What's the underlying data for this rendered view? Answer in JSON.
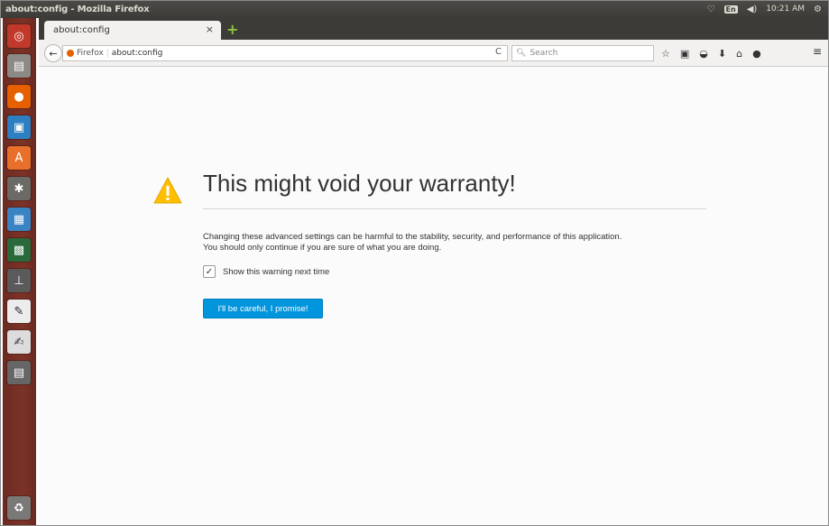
{
  "window": {
    "title": "about:config - Mozilla Firefox"
  },
  "panel": {
    "keyboard_badge": "En",
    "time": "10:21 AM"
  },
  "tabs": [
    {
      "label": "about:config",
      "close": "×"
    }
  ],
  "newtab": {
    "label": "+"
  },
  "navbar": {
    "back": "←",
    "identity": "Firefox",
    "url": "about:config",
    "reload": "C",
    "search_placeholder": "Search",
    "menu": "≡"
  },
  "content": {
    "title": "This might void your warranty!",
    "description_line1": "Changing these advanced settings can be harmful to the stability, security, and performance of this application.",
    "description_line2": "You should only continue if you are sure of what you are doing.",
    "checkbox_label": "Show this warning next time",
    "checkbox_checked": true,
    "checkbox_mark": "✓",
    "button_label": "I'll be careful, I promise!"
  },
  "colors": {
    "accent_button": "#0095dd",
    "warning_icon": "#ffbf00",
    "launcher": "#7d3326",
    "panel": "#3c3b37"
  },
  "launcher_icons": [
    "ubuntu-dash-icon",
    "files-icon",
    "firefox-icon",
    "libreoffice-writer-icon",
    "software-center-icon",
    "system-settings-icon",
    "display-icon",
    "terminal-icon",
    "usb-icon",
    "inkscape-icon",
    "text-editor-icon",
    "video-icon",
    "trash-icon"
  ]
}
